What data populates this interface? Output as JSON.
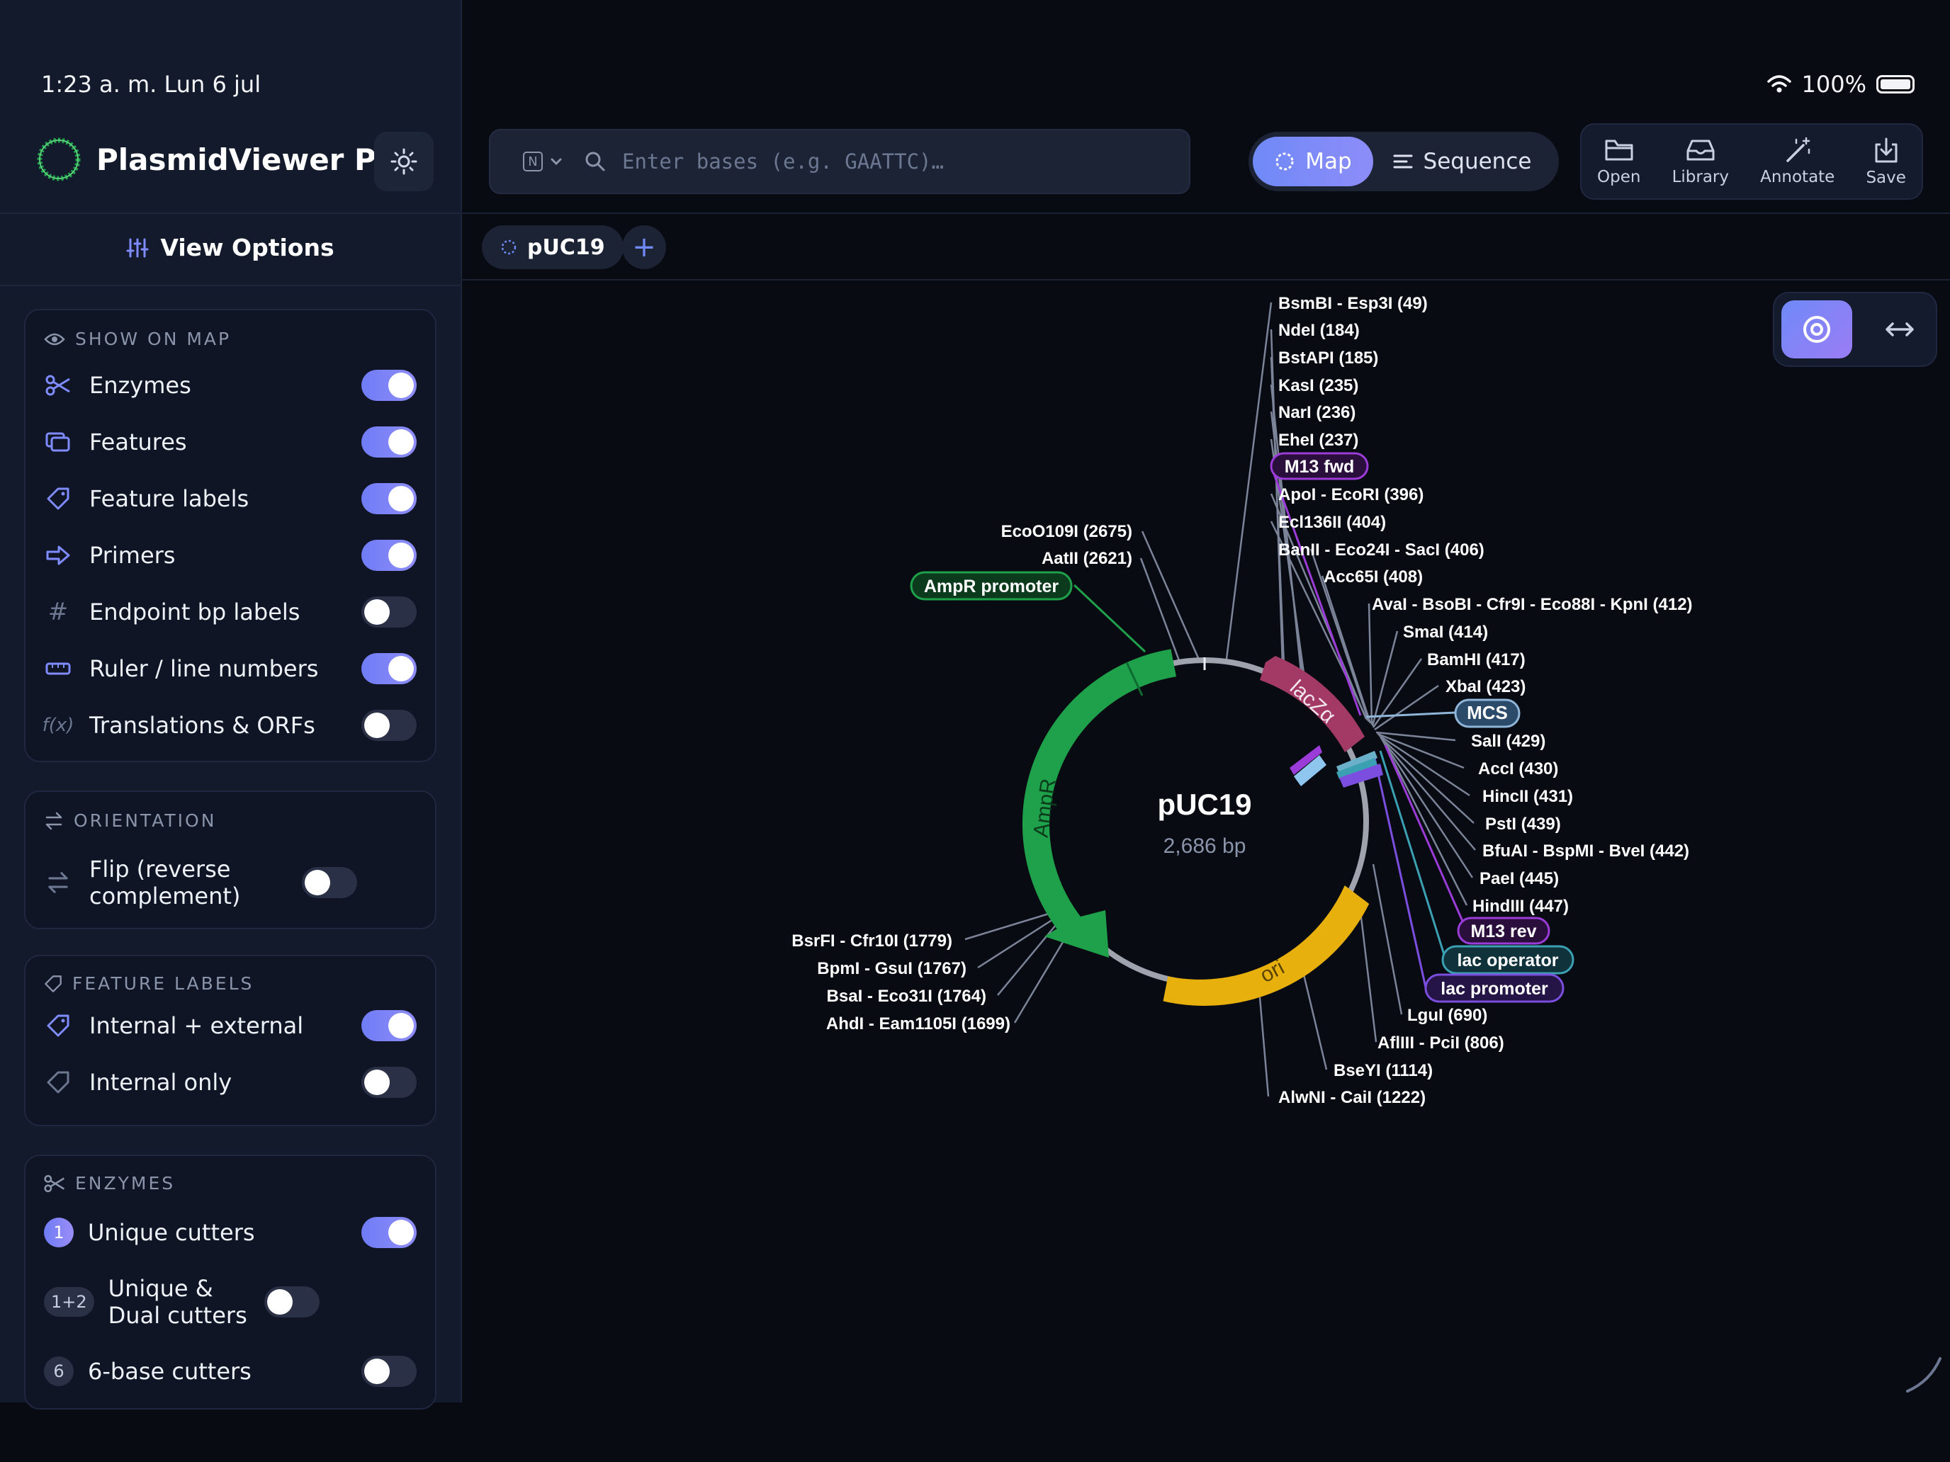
{
  "status": {
    "time": "1:23 a. m.   Lun 6 jul",
    "battery": "100%"
  },
  "app": {
    "title": "PlasmidViewer Pro"
  },
  "sidebar": {
    "view_options": "View Options",
    "show_on_map": {
      "heading": "SHOW ON MAP",
      "items": [
        {
          "label": "Enzymes",
          "on": true,
          "icon": "scissors-icon"
        },
        {
          "label": "Features",
          "on": true,
          "icon": "layers-icon"
        },
        {
          "label": "Feature labels",
          "on": true,
          "icon": "tag-icon"
        },
        {
          "label": "Primers",
          "on": true,
          "icon": "arrow-right-icon"
        },
        {
          "label": "Endpoint bp labels",
          "on": false,
          "icon": "hash-icon"
        },
        {
          "label": "Ruler / line numbers",
          "on": true,
          "icon": "ruler-icon"
        },
        {
          "label": "Translations & ORFs",
          "on": false,
          "icon": "function-icon"
        }
      ]
    },
    "orientation": {
      "heading": "ORIENTATION",
      "items": [
        {
          "label": "Flip (reverse complement)",
          "on": false
        }
      ]
    },
    "feature_labels": {
      "heading": "FEATURE LABELS",
      "items": [
        {
          "label": "Internal + external",
          "on": true
        },
        {
          "label": "Internal only",
          "on": false
        }
      ]
    },
    "enzymes": {
      "heading": "ENZYMES",
      "items": [
        {
          "badge": "1",
          "label": "Unique cutters",
          "on": true
        },
        {
          "badge": "1+2",
          "label": "Unique & Dual cutters",
          "on": false
        },
        {
          "badge": "6",
          "label": "6-base cutters",
          "on": false
        }
      ]
    }
  },
  "toolbar": {
    "search_mode": "N",
    "search_placeholder": "Enter bases (e.g. GAATTC)…",
    "segments": [
      "Map",
      "Sequence"
    ],
    "tools": [
      "Open",
      "Library",
      "Annotate",
      "Save"
    ]
  },
  "tabs": {
    "active": "pUC19",
    "add": "+"
  },
  "map": {
    "name": "pUC19",
    "length": "2,686 bp",
    "features": [
      {
        "label": "AmpR",
        "color": "#1fa04a"
      },
      {
        "label": "lacZα",
        "color": "#a33a66"
      },
      {
        "label": "ori",
        "color": "#e8b00c"
      }
    ],
    "right_labels": [
      "BsmBI - Esp3I (49)",
      "NdeI (184)",
      "BstAPI (185)",
      "KasI (235)",
      "NarI (236)",
      "EheI (237)",
      "M13 fwd",
      "ApoI - EcoRI (396)",
      "Ecl136II (404)",
      "BanII - Eco24I - SacI (406)",
      "Acc65I (408)",
      "AvaI - BsoBI - Cfr9I - Eco88I - KpnI (412)",
      "SmaI (414)",
      "BamHI (417)",
      "XbaI (423)",
      "MCS",
      "SalI (429)",
      "AccI (430)",
      "HincII (431)",
      "PstI (439)",
      "BfuAI - BspMI - BveI (442)",
      "PaeI (445)",
      "HindIII (447)",
      "M13 rev",
      "lac operator",
      "lac promoter",
      "LguI (690)",
      "AflIII - PciI (806)",
      "BseYI (1114)",
      "AlwNI - CaiI (1222)"
    ],
    "left_labels": [
      "EcoO109I (2675)",
      "AatII (2621)",
      "AmpR promoter",
      "BsrFI - Cfr10I (1779)",
      "BpmI - GsuI (1767)",
      "BsaI - Eco31I (1764)",
      "AhdI - Eam1105I (1699)"
    ]
  }
}
